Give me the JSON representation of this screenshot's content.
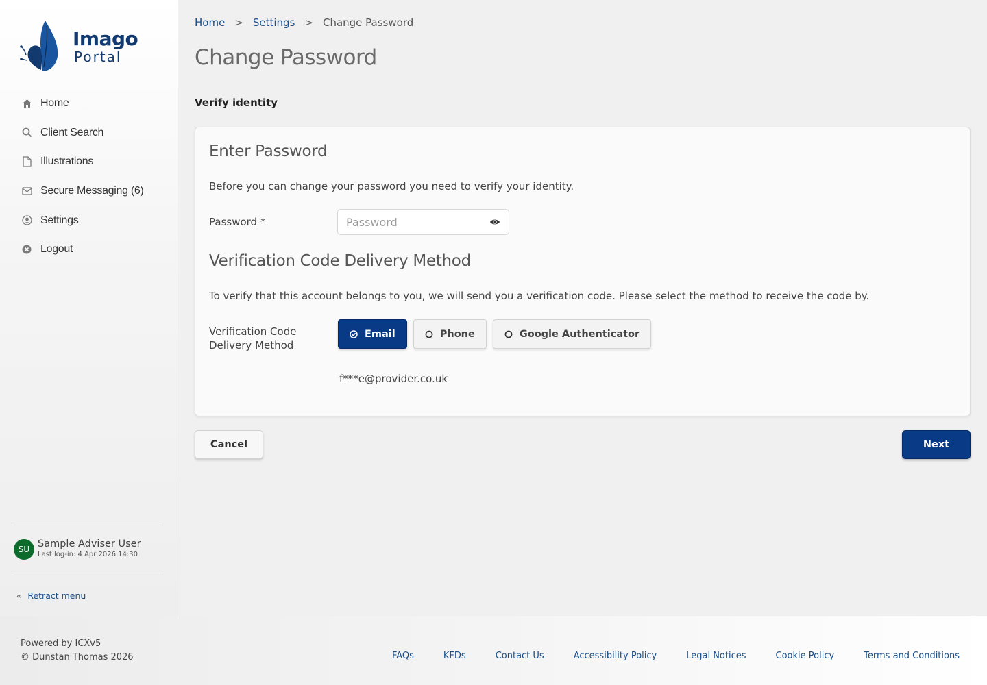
{
  "brand": {
    "name": "Imago",
    "subtitle": "Portal",
    "color": "#123a6e"
  },
  "sidebar": {
    "items": [
      {
        "label": "Home",
        "icon": "home-icon"
      },
      {
        "label": "Client Search",
        "icon": "search-icon"
      },
      {
        "label": "Illustrations",
        "icon": "document-icon"
      },
      {
        "label": "Secure Messaging (6)",
        "icon": "envelope-icon"
      },
      {
        "label": "Settings",
        "icon": "user-circle-icon"
      },
      {
        "label": "Logout",
        "icon": "close-circle-icon"
      }
    ],
    "user": {
      "initials": "SU",
      "name": "Sample Adviser User",
      "last_login": "Last log-in: 4 Apr 2026 14:30",
      "avatar_color": "#0d6b2c"
    },
    "retract_label": "Retract menu"
  },
  "breadcrumb": {
    "home": "Home",
    "sep1": ">",
    "settings": "Settings",
    "sep2": ">",
    "current": "Change Password"
  },
  "page": {
    "title": "Change Password",
    "section_label": "Verify identity",
    "enter_password": {
      "heading": "Enter Password",
      "description": "Before you can change your password you need to verify your identity.",
      "field_label": "Password *",
      "placeholder": "Password",
      "value": ""
    },
    "verification": {
      "heading": "Verification Code Delivery Method",
      "description": "To verify that this account belongs to you, we will send you a verification code. Please select the method to receive the code by.",
      "field_label_line1": "Verification Code",
      "field_label_line2": "Delivery Method",
      "methods": [
        {
          "label": "Email",
          "selected": true
        },
        {
          "label": "Phone",
          "selected": false
        },
        {
          "label": "Google Authenticator",
          "selected": false
        }
      ],
      "masked_destination": "f***e@provider.co.uk"
    },
    "cancel_label": "Cancel",
    "next_label": "Next"
  },
  "footer": {
    "powered_by": "Powered by ICXv5",
    "copyright": "© Dunstan Thomas 2026",
    "links": [
      "FAQs",
      "KFDs",
      "Contact Us",
      "Accessibility Policy",
      "Legal Notices",
      "Cookie Policy",
      "Terms and Conditions"
    ]
  },
  "colors": {
    "primary": "#083a85",
    "link": "#1a4f8a"
  }
}
